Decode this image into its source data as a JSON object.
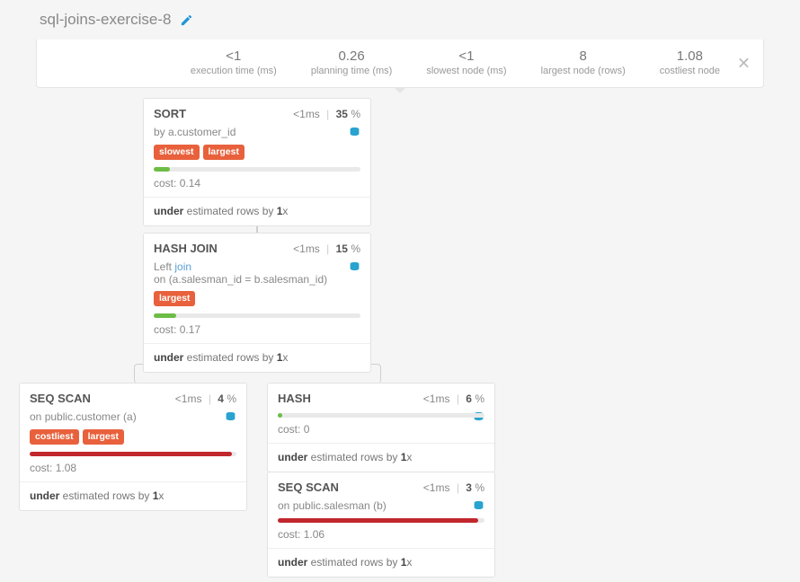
{
  "title": "sql-joins-exercise-8",
  "stats": [
    {
      "value": "<1",
      "label": "execution time (ms)"
    },
    {
      "value": "0.26",
      "label": "planning time (ms)"
    },
    {
      "value": "<1",
      "label": "slowest node (ms)"
    },
    {
      "value": "8",
      "label": "largest node (rows)"
    },
    {
      "value": "1.08",
      "label": "costliest node"
    }
  ],
  "nodes": {
    "sort": {
      "title": "SORT",
      "time": "<1",
      "time_unit": "ms",
      "pct": "35",
      "sub_prefix": "by ",
      "sub_mono": "a.customer_id",
      "tags": [
        "slowest",
        "largest"
      ],
      "bar_color": "green",
      "bar_pct": 8,
      "cost_label": "cost:",
      "cost": "0.14",
      "est_bold": "under",
      "est_mid": " estimated rows by ",
      "est_val": "1",
      "est_suffix": "x"
    },
    "hashjoin": {
      "title": "HASH JOIN",
      "time": "<1",
      "time_unit": "ms",
      "pct": "15",
      "sub_left": "Left ",
      "sub_join": "join",
      "sub_on_prefix": "on ",
      "sub_on_expr": "(a.salesman_id = b.salesman_id)",
      "tags": [
        "largest"
      ],
      "bar_color": "green",
      "bar_pct": 11,
      "cost_label": "cost:",
      "cost": "0.17",
      "est_bold": "under",
      "est_mid": " estimated rows by ",
      "est_val": "1",
      "est_suffix": "x"
    },
    "seqscan_cust": {
      "title": "SEQ SCAN",
      "time": "<1",
      "time_unit": "ms",
      "pct": "4",
      "sub_prefix": "on ",
      "sub_mono": "public.customer (a)",
      "tags": [
        "costliest",
        "largest"
      ],
      "bar_color": "red",
      "bar_pct": 98,
      "cost_label": "cost:",
      "cost": "1.08",
      "est_bold": "under",
      "est_mid": " estimated rows by ",
      "est_val": "1",
      "est_suffix": "x"
    },
    "hash": {
      "title": "HASH",
      "time": "<1",
      "time_unit": "ms",
      "pct": "6",
      "bar_color": "green",
      "bar_pct": 2,
      "cost_label": "cost:",
      "cost": "0",
      "est_bold": "under",
      "est_mid": " estimated rows by ",
      "est_val": "1",
      "est_suffix": "x"
    },
    "seqscan_sales": {
      "title": "SEQ SCAN",
      "time": "<1",
      "time_unit": "ms",
      "pct": "3",
      "sub_prefix": "on ",
      "sub_mono": "public.salesman (b)",
      "bar_color": "red",
      "bar_pct": 97,
      "cost_label": "cost:",
      "cost": "1.06",
      "est_bold": "under",
      "est_mid": " estimated rows by ",
      "est_val": "1",
      "est_suffix": "x"
    }
  },
  "percent_sign": " %"
}
